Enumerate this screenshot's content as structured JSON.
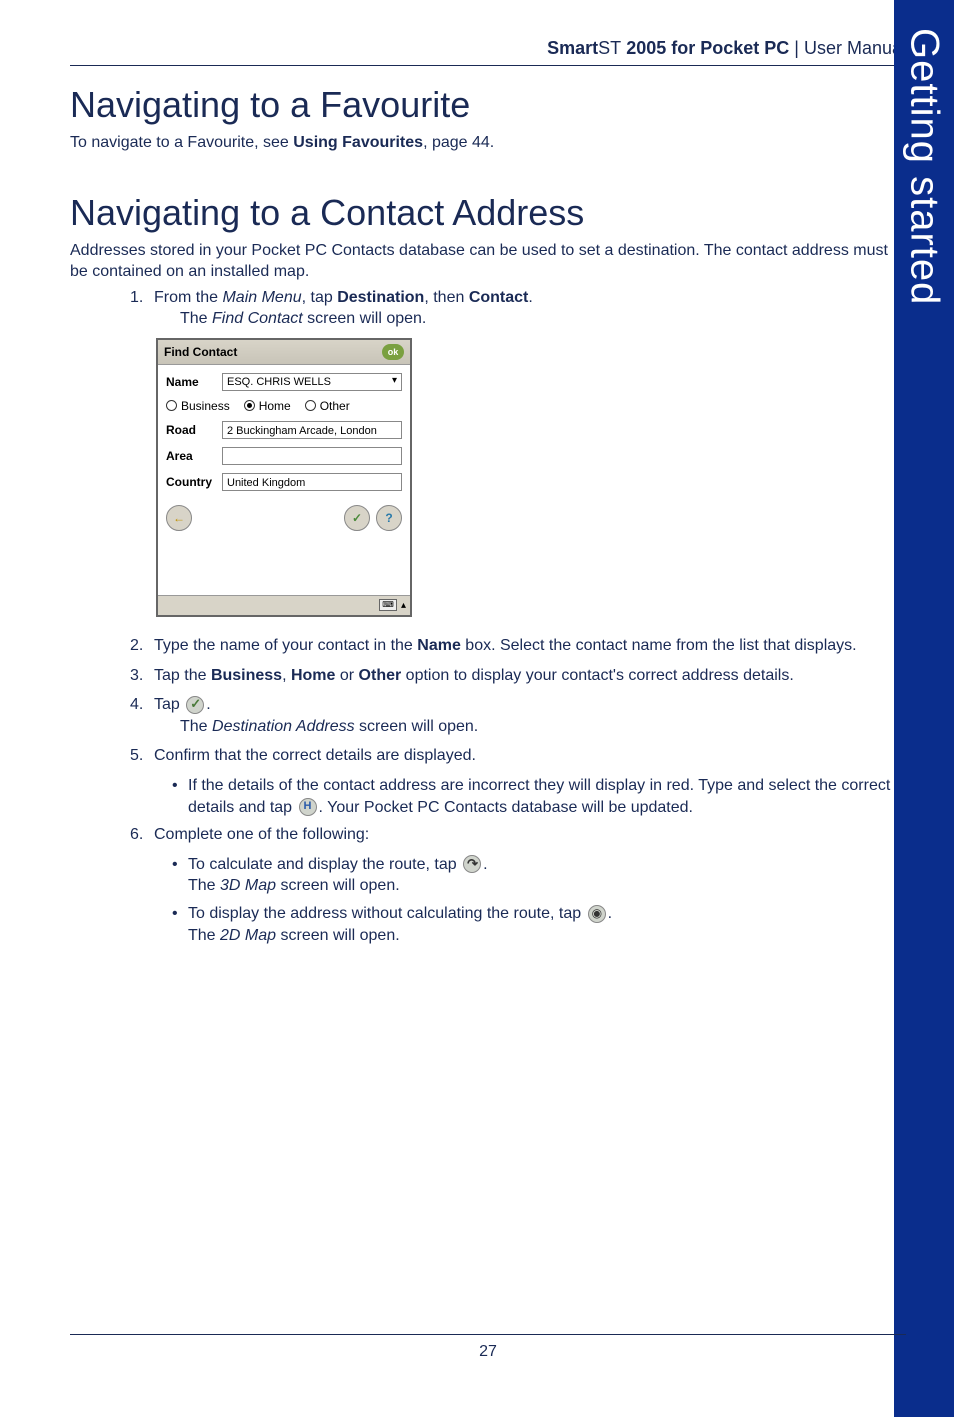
{
  "header": {
    "brand_strong": "Smart",
    "brand_thin": "ST",
    "brand_suffix": " 2005 for Pocket PC",
    "sep": " | ",
    "doc_type": "User Manual"
  },
  "sidebar": {
    "label": "Getting started"
  },
  "section1": {
    "heading": "Navigating to a Favourite",
    "p1_a": "To navigate to a Favourite, see ",
    "p1_bold": "Using Favourites",
    "p1_b": ", page 44."
  },
  "section2": {
    "heading": "Navigating to a Contact Address",
    "intro": "Addresses stored in your Pocket PC Contacts database can be used to set a destination. The contact address must be contained on an installed map.",
    "step1_num": "1.",
    "step1_a": "From the ",
    "step1_i": "Main Menu",
    "step1_b": ", tap ",
    "step1_bold1": "Destination",
    "step1_c": ", then ",
    "step1_bold2": "Contact",
    "step1_d": ".",
    "step1_sub_a": "The ",
    "step1_sub_i": "Find Contact",
    "step1_sub_b": " screen will open.",
    "step2_num": "2.",
    "step2_a": "Type the name of your contact in the ",
    "step2_bold": "Name",
    "step2_b": " box. Select the contact name from the list that displays.",
    "step3_num": "3.",
    "step3_a": "Tap the ",
    "step3_bold1": "Business",
    "step3_b": ", ",
    "step3_bold2": "Home",
    "step3_c": " or ",
    "step3_bold3": "Other",
    "step3_d": " option to display your contact's correct address details.",
    "step4_num": "4.",
    "step4_a": "Tap ",
    "step4_b": ".",
    "step4_sub_a": "The ",
    "step4_sub_i": "Destination Address",
    "step4_sub_b": " screen will open.",
    "step5_num": "5.",
    "step5_a": "Confirm that the correct details are displayed.",
    "step5_b1_a": "If the details of the contact address are incorrect they will display in red. Type and select the correct details and tap ",
    "step5_b1_b": ". Your Pocket PC Contacts database will be updated.",
    "step6_num": "6.",
    "step6_a": "Complete one of the following:",
    "step6_b1_a": "To calculate and display the route, tap ",
    "step6_b1_b": ".",
    "step6_b1_sub_a": "The ",
    "step6_b1_sub_i": "3D Map",
    "step6_b1_sub_b": " screen will open.",
    "step6_b2_a": "To display the address without calculating the route, tap ",
    "step6_b2_b": ".",
    "step6_b2_sub_a": "The ",
    "step6_b2_sub_i": "2D Map",
    "step6_b2_sub_b": " screen will open."
  },
  "ppc": {
    "title": "Find Contact",
    "ok": "ok",
    "name_label": "Name",
    "name_value": "ESQ. CHRIS WELLS",
    "radio_business": "Business",
    "radio_home": "Home",
    "radio_other": "Other",
    "road_label": "Road",
    "road_value": "2 Buckingham Arcade, London",
    "area_label": "Area",
    "area_value": "",
    "country_label": "Country",
    "country_value": "United Kingdom",
    "back_glyph": "←",
    "ok_glyph": "✓",
    "help_glyph": "?",
    "kbd_glyph": "⌨",
    "up_glyph": "▴"
  },
  "footer": {
    "page_number": "27"
  }
}
